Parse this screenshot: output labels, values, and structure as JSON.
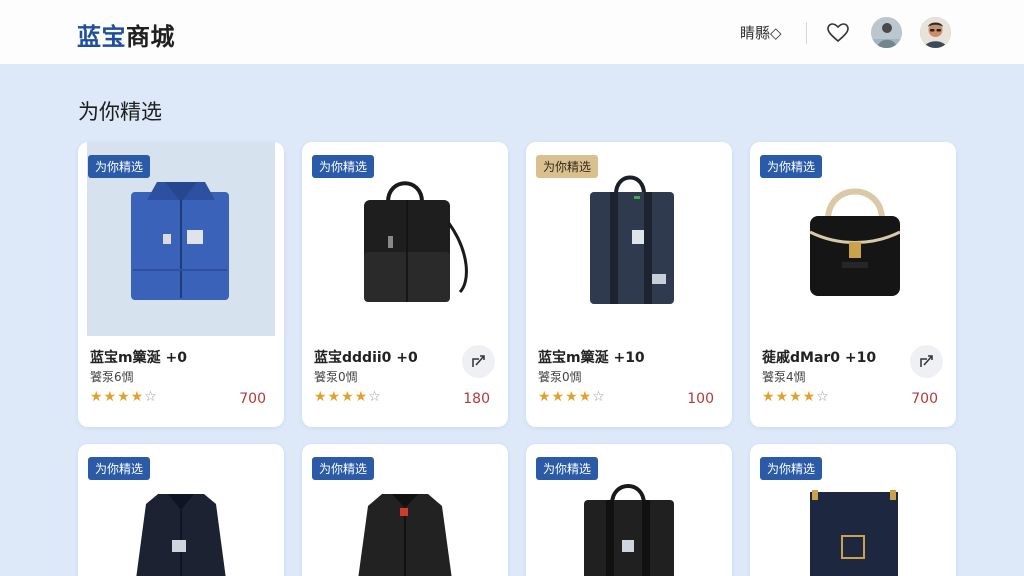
{
  "app": {
    "logo_part1": "蓝宝",
    "logo_part2": "商城"
  },
  "header": {
    "filter_label": "睛縣◇",
    "icons": [
      "heart-icon",
      "avatar",
      "avatar"
    ]
  },
  "section": {
    "title": "为你精选"
  },
  "products_row1": [
    {
      "badge": "为你精选",
      "name": "蓝宝m篥涎 +0",
      "sub": "饕泵6惆",
      "rating": 4,
      "price": "700",
      "has_share": false,
      "image": "blue-jacket"
    },
    {
      "badge": "为你精选",
      "name": "蓝宝dddii0 +0",
      "sub": "饕泵0惆",
      "rating": 4,
      "price": "180",
      "has_share": true,
      "image": "black-bag"
    },
    {
      "badge": "为你精选",
      "name": "蓝宝m篥涎 +10",
      "sub": "饕泵0惆",
      "rating": 4,
      "price": "100",
      "has_share": false,
      "image": "navy-tote"
    },
    {
      "badge": "为你精选",
      "name": "蓰戚dMar0 +10",
      "sub": "饕泵4惆",
      "rating": 4,
      "price": "700",
      "has_share": true,
      "image": "black-satchel"
    }
  ],
  "products_row2": [
    {
      "badge": "为你精选",
      "image": "navy-shirt"
    },
    {
      "badge": "为你精选",
      "image": "black-shirt"
    },
    {
      "badge": "为你精选",
      "image": "black-tote"
    },
    {
      "badge": "为你精选",
      "image": "navy-bag"
    }
  ],
  "colors": {
    "brand_blue": "#1f4e9c",
    "badge_blue": "#2b5ba8",
    "badge_gold": "#d9c08e",
    "price_red": "#b33a3a",
    "star_gold": "#e4a12a",
    "page_bg": "#dde8f9"
  }
}
